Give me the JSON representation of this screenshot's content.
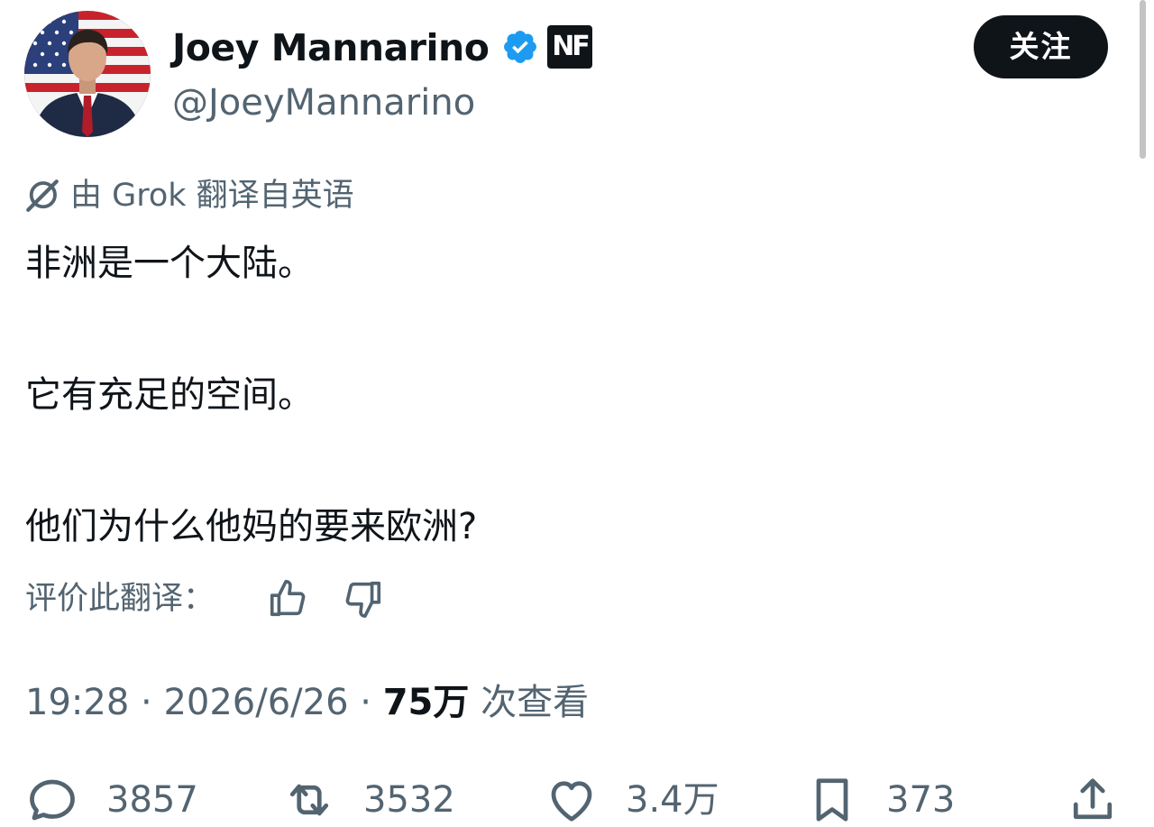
{
  "author": {
    "display_name": "Joey Mannarino",
    "handle": "@JoeyMannarino",
    "verified_badge": "verified-check-icon",
    "affiliate_badge": "NF",
    "follow_label": "关注"
  },
  "translation": {
    "note": "由 Grok 翻译自英语",
    "rate_label": "评价此翻译："
  },
  "tweet": {
    "lines": [
      "非洲是一个大陆。",
      "它有充足的空间。",
      "他们为什么他妈的要来欧洲?"
    ]
  },
  "meta": {
    "time": "19:28",
    "date": "2026/6/26",
    "views": "75万",
    "views_suffix": "次查看",
    "separator": "·"
  },
  "actions": {
    "replies": "3857",
    "reposts": "3532",
    "likes": "3.4万",
    "bookmarks": "373"
  },
  "colors": {
    "text": "#0f1419",
    "secondary": "#536471",
    "verified": "#1d9bf0",
    "button_bg": "#0f1419"
  }
}
